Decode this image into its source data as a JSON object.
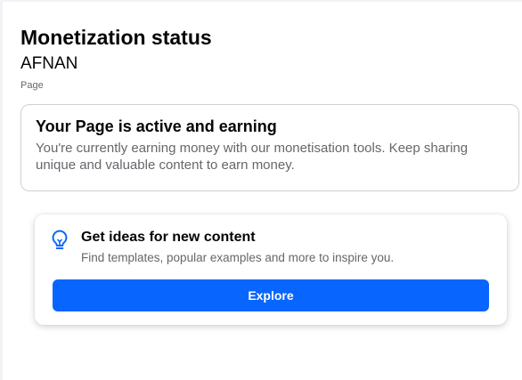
{
  "header": {
    "title": "Monetization status",
    "page_name": "AFNAN",
    "page_type": "Page"
  },
  "status_card": {
    "title": "Your Page is active and earning",
    "description": "You're currently earning money with our monetisation tools. Keep sharing unique and valuable content to earn money."
  },
  "ideas_card": {
    "icon": "lightbulb-icon",
    "title": "Get ideas for new content",
    "description": "Find templates, popular examples and more to inspire you.",
    "button_label": "Explore"
  },
  "colors": {
    "accent": "#0866ff",
    "text_primary": "#050505",
    "text_secondary": "#65676b",
    "border": "#ced0d4"
  }
}
